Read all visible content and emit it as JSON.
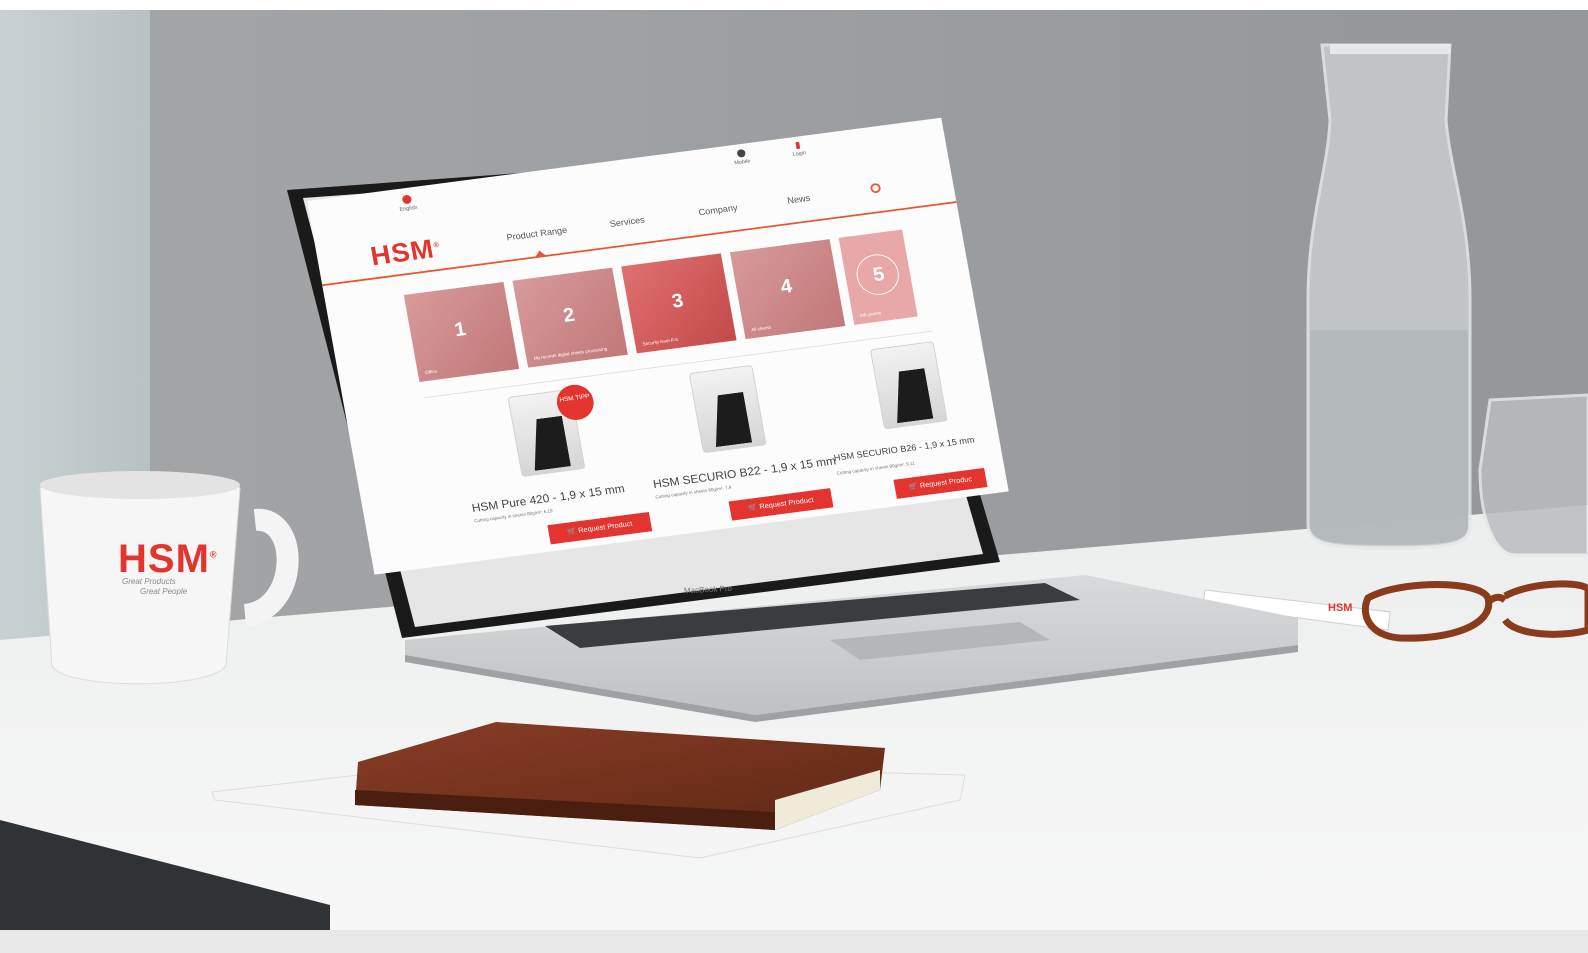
{
  "site": {
    "language": "English",
    "utility": {
      "mobile": "Mobile",
      "login": "Login"
    },
    "logo": "HSM",
    "nav": [
      "Product Range",
      "Services",
      "Company",
      "News"
    ],
    "categories": [
      {
        "num": "1",
        "caption": "Office"
      },
      {
        "num": "2",
        "caption": "My records digital sheets processing"
      },
      {
        "num": "3",
        "caption": "Security level P-5"
      },
      {
        "num": "4",
        "caption": "All sheets"
      },
      {
        "num": "5",
        "caption": "Info points"
      }
    ],
    "products": [
      {
        "title": "HSM Pure 420 - 1,9 x 15 mm",
        "desc": "Cutting capacity in sheets 80g/m²: 6,19",
        "badge": "HSM TIPP",
        "button": "Request Product"
      },
      {
        "title": "HSM SECURIO B22 - 1,9 x 15 mm",
        "desc": "Cutting capacity in sheets 80g/m²: 7,9",
        "button": "Request Product"
      },
      {
        "title": "HSM SECURIO B26 - 1,9 x 15 mm",
        "desc": "Cutting capacity in sheets 80g/m²: 9,11",
        "button": "Request Produc"
      }
    ]
  },
  "mug": {
    "logo": "HSM",
    "slogan_line1": "Great Products",
    "slogan_line2": "Great People"
  },
  "pen": {
    "logo": "HSM"
  },
  "laptop_label": "MacBook Pro",
  "colors": {
    "brand_red": "#e3342f",
    "accent_orange": "#e8552f",
    "wall": "#9a9c9e",
    "desk": "#f2f2f2"
  }
}
